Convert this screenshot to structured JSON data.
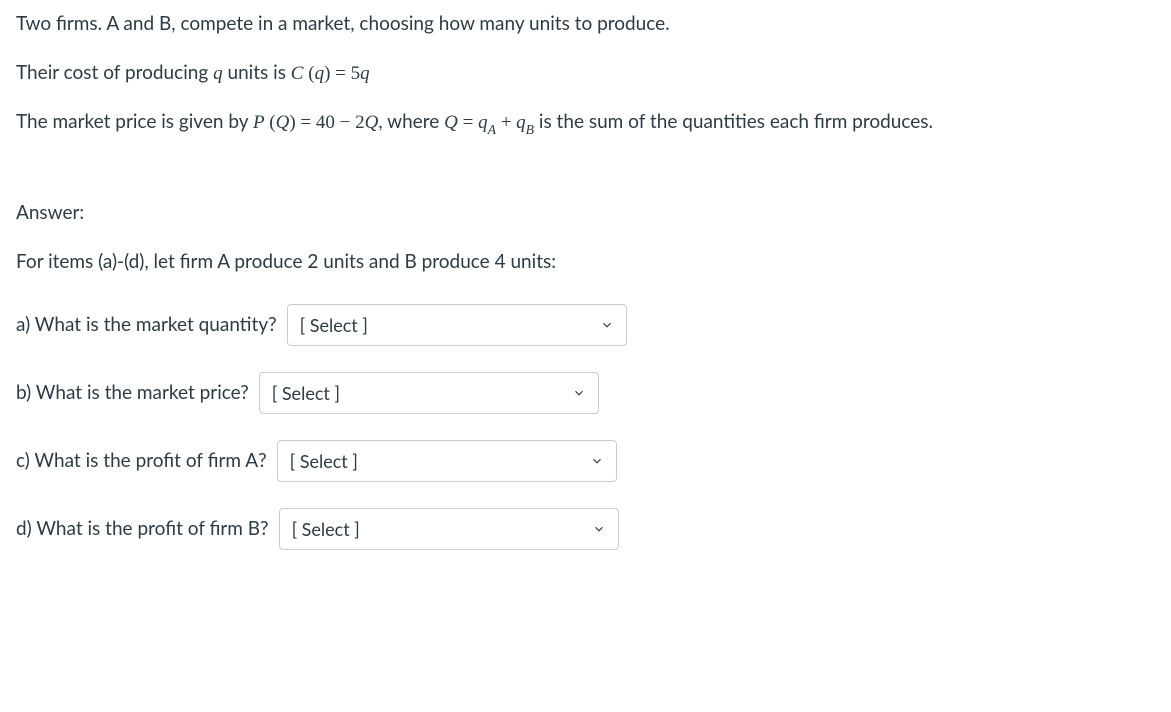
{
  "problem": {
    "intro": "Two firms. A and B, compete in a market, choosing how many units to produce.",
    "cost_pre": "Their cost of producing ",
    "cost_var": "q",
    "cost_mid": " units is ",
    "cost_eq_lhs_fn": "C",
    "cost_eq_lhs_arg": "q",
    "cost_eq_rhs": "5q",
    "price_pre": "The market price is given by ",
    "price_eq_lhs_fn": "P",
    "price_eq_lhs_arg": "Q",
    "price_eq_rhs": "40 − 2Q",
    "price_mid1": ", where ",
    "price_sum_lhs": "Q",
    "price_sum_qa": "q",
    "price_sum_subA": "A",
    "price_sum_qb": "q",
    "price_sum_subB": "B",
    "price_post": " is the sum of the quantities each firm produces."
  },
  "answer": {
    "label": "Answer:",
    "instr": "For items (a)-(d), let firm A produce 2 units and B produce 4 units:"
  },
  "questions": {
    "a": {
      "text": "a) What is the market quantity?",
      "placeholder": "[ Select ]"
    },
    "b": {
      "text": "b) What is the market price?",
      "placeholder": "[ Select ]"
    },
    "c": {
      "text": "c) What is the profit of firm A?",
      "placeholder": "[ Select ]"
    },
    "d": {
      "text": "d) What is the profit of firm B?",
      "placeholder": "[ Select ]"
    }
  }
}
